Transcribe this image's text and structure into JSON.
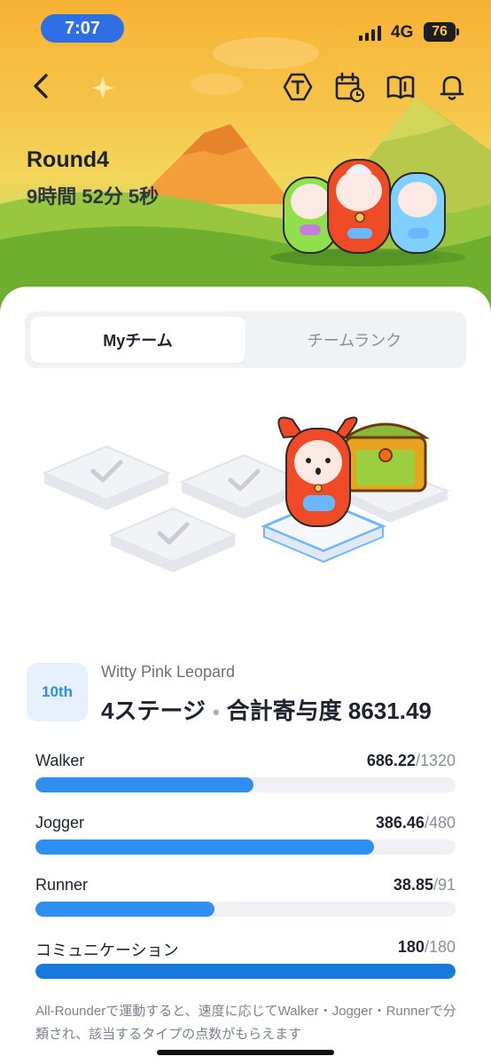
{
  "status_bar": {
    "time": "7:07",
    "network": "4G",
    "battery": "76"
  },
  "header": {
    "round_title": "Round4",
    "countdown": "9時間 52分 5秒",
    "icons": [
      "back-icon",
      "ticket-icon",
      "calendar-clock-icon",
      "book-icon",
      "bell-icon"
    ]
  },
  "tabs": [
    {
      "label": "Myチーム",
      "active": true
    },
    {
      "label": "チームランク",
      "active": false
    }
  ],
  "team": {
    "rank": "10th",
    "name": "Witty Pink Leopard",
    "stages": "4ステージ",
    "separator": "•",
    "contribution_label": "合計寄与度 8631.49"
  },
  "progress": [
    {
      "label": "Walker",
      "value": "686.22",
      "max": "/1320",
      "fraction": 0.52
    },
    {
      "label": "Jogger",
      "value": "386.46",
      "max": "/480",
      "fraction": 0.805
    },
    {
      "label": "Runner",
      "value": "38.85",
      "max": "/91",
      "fraction": 0.427
    },
    {
      "label": "コミュニケーション",
      "value": "180",
      "max": "/180",
      "fraction": 1.0
    }
  ],
  "note": "All-Rounderで運動すると、速度に応じてWalker・Jogger・Runnerで分類され、該当するタイプの点数がもらえます",
  "colors": {
    "accent": "#2e8ff0",
    "full": "#1679db",
    "rank_bg": "#e6f1fd"
  }
}
